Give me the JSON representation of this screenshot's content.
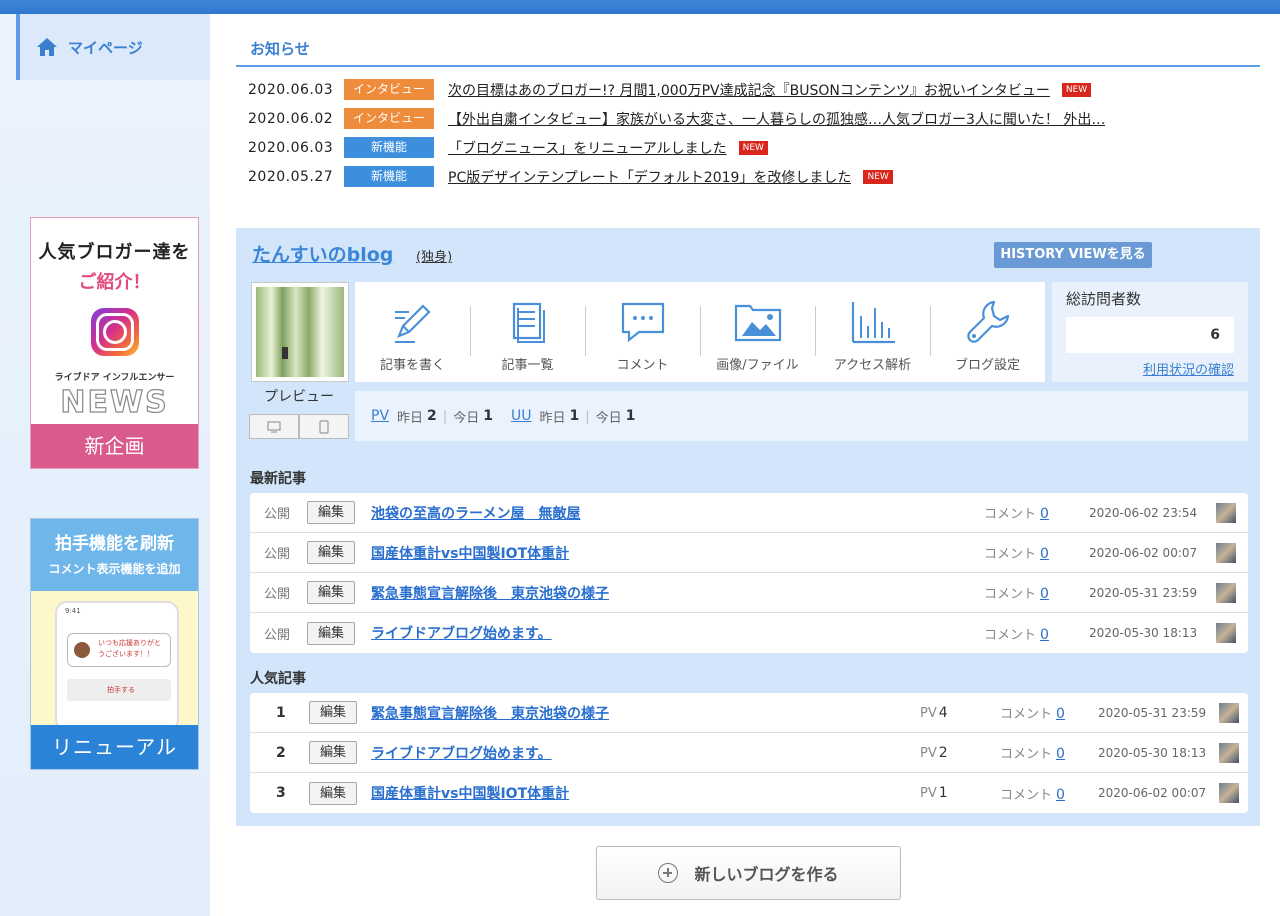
{
  "sidebar": {
    "mypage_label": "マイページ",
    "ad1": {
      "line1": "人気ブロガー達を",
      "line2": "ご紹介！",
      "line3": "ライブドア インフルエンサー",
      "line4": "NEWS",
      "footer": "新企画"
    },
    "ad2": {
      "line1": "拍手機能を刷新",
      "line2": "コメント表示機能を追加",
      "time": "9:41",
      "bubble": "いつも応援ありがとうございます！！",
      "clap": "拍手する",
      "footer": "リニューアル"
    }
  },
  "news": {
    "title": "お知らせ",
    "items": [
      {
        "date": "2020.06.03",
        "tag": "インタビュー",
        "tag_type": "interview",
        "text": "次の目標はあのブロガー!? 月間1,000万PV達成記念『BUSONコンテンツ』お祝いインタビュー",
        "new": "NEW"
      },
      {
        "date": "2020.06.02",
        "tag": "インタビュー",
        "tag_type": "interview",
        "text": "【外出自粛インタビュー】家族がいる大変さ、一人暮らしの孤独感…人気ブロガー3人に聞いた！ 外出…",
        "new": ""
      },
      {
        "date": "2020.06.03",
        "tag": "新機能",
        "tag_type": "feature",
        "text": "「ブログニュース」をリニューアルしました",
        "new": "NEW"
      },
      {
        "date": "2020.05.27",
        "tag": "新機能",
        "tag_type": "feature",
        "text": "PC版デザインテンプレート「デフォルト2019」を改修しました",
        "new": "NEW"
      }
    ]
  },
  "blog": {
    "name": "たんすいのblog",
    "subtitle": "(独身)",
    "history_button": "HISTORY VIEWを見る",
    "preview_label": "プレビュー",
    "tools": [
      {
        "label": "記事を書く",
        "icon": "pencil-icon"
      },
      {
        "label": "記事一覧",
        "icon": "document-list-icon"
      },
      {
        "label": "コメント",
        "icon": "comment-icon"
      },
      {
        "label": "画像/ファイル",
        "icon": "image-folder-icon"
      },
      {
        "label": "アクセス解析",
        "icon": "bar-chart-icon"
      },
      {
        "label": "ブログ設定",
        "icon": "wrench-icon"
      }
    ],
    "visits": {
      "label": "総訪問者数",
      "value": "6",
      "link": "利用状況の確認"
    },
    "stats": {
      "pv_label": "PV",
      "yesterday_label": "昨日",
      "pv_yesterday": "2",
      "today_label": "今日",
      "pv_today": "1",
      "uu_label": "UU",
      "uu_yesterday": "1",
      "uu_today": "1",
      "sep": "|"
    },
    "latest_title": "最新記事",
    "latest": [
      {
        "status": "公開",
        "edit": "編集",
        "title": "池袋の至高のラーメン屋　無敵屋",
        "comment_label": "コメント",
        "comments": "0",
        "date": "2020-06-02 23:54"
      },
      {
        "status": "公開",
        "edit": "編集",
        "title": "国産体重計vs中国製IOT体重計",
        "comment_label": "コメント",
        "comments": "0",
        "date": "2020-06-02 00:07"
      },
      {
        "status": "公開",
        "edit": "編集",
        "title": "緊急事態宣言解除後　東京池袋の様子",
        "comment_label": "コメント",
        "comments": "0",
        "date": "2020-05-31 23:59"
      },
      {
        "status": "公開",
        "edit": "編集",
        "title": "ライブドアブログ始めます。",
        "comment_label": "コメント",
        "comments": "0",
        "date": "2020-05-30 18:13"
      }
    ],
    "popular_title": "人気記事",
    "popular": [
      {
        "rank": "1",
        "edit": "編集",
        "title": "緊急事態宣言解除後　東京池袋の様子",
        "pv_label": "PV",
        "pv": "4",
        "comment_label": "コメント",
        "comments": "0",
        "date": "2020-05-31 23:59"
      },
      {
        "rank": "2",
        "edit": "編集",
        "title": "ライブドアブログ始めます。",
        "pv_label": "PV",
        "pv": "2",
        "comment_label": "コメント",
        "comments": "0",
        "date": "2020-05-30 18:13"
      },
      {
        "rank": "3",
        "edit": "編集",
        "title": "国産体重計vs中国製IOT体重計",
        "pv_label": "PV",
        "pv": "1",
        "comment_label": "コメント",
        "comments": "0",
        "date": "2020-06-02 00:07"
      }
    ]
  },
  "new_blog_button": "新しいブログを作る"
}
